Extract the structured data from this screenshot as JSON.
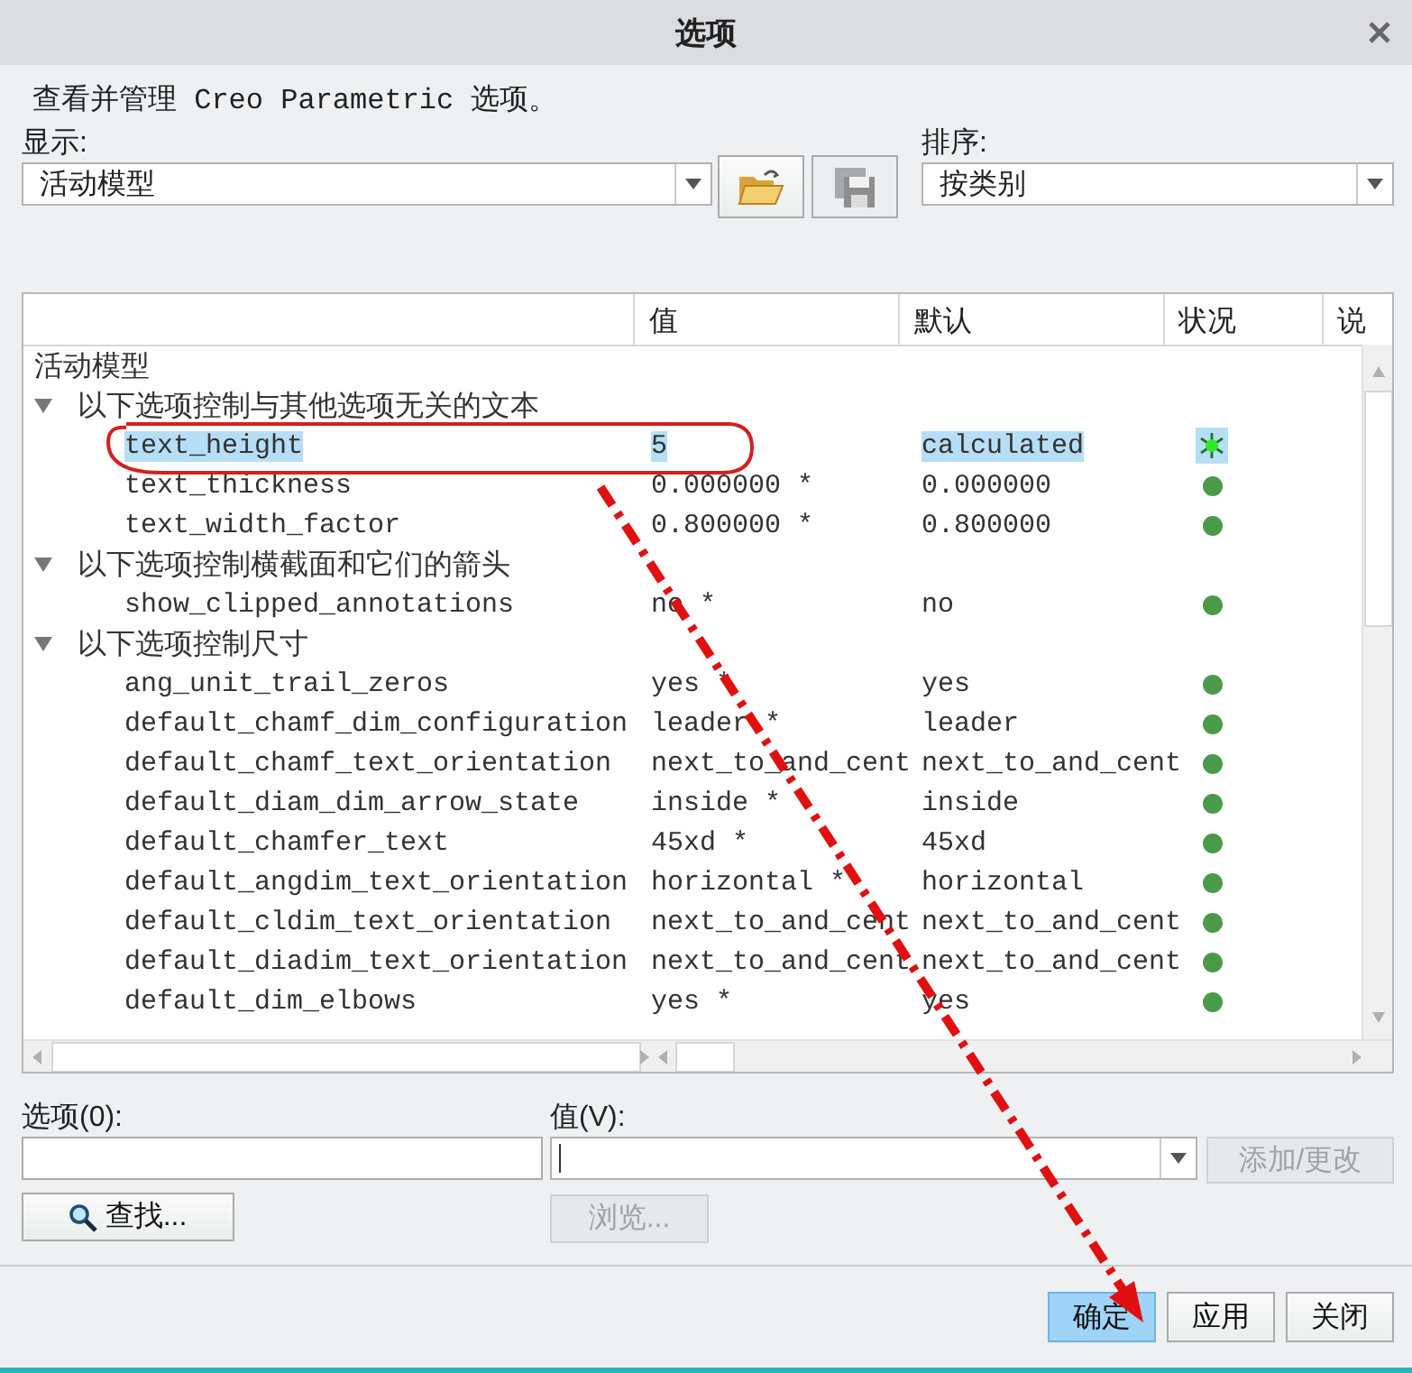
{
  "window": {
    "title": "选项"
  },
  "description": "查看并管理 Creo Parametric 选项。",
  "display": {
    "label": "显示:",
    "value": "活动模型"
  },
  "toolbar": [
    {
      "kind": "open",
      "disabled": false
    },
    {
      "kind": "save",
      "disabled": true
    }
  ],
  "sort": {
    "label": "排序:",
    "value": "按类别"
  },
  "table": {
    "columns": [
      "值",
      "默认",
      "状况",
      "说"
    ],
    "tree": {
      "label": "活动模型",
      "children": [
        {
          "label": "以下选项控制与其他选项无关的文本",
          "expanded": true,
          "children": [
            {
              "name": "text_height",
              "value": "5",
              "default": "calculated",
              "selected": true,
              "pending": true
            },
            {
              "name": "text_thickness",
              "value": "0.000000 *",
              "default": "0.000000",
              "selected": false,
              "pending": false
            },
            {
              "name": "text_width_factor",
              "value": "0.800000 *",
              "default": "0.800000",
              "selected": false,
              "pending": false
            }
          ]
        },
        {
          "label": "以下选项控制横截面和它们的箭头",
          "expanded": true,
          "children": [
            {
              "name": "show_clipped_annotations",
              "value": "no *",
              "default": "no",
              "selected": false,
              "pending": false
            }
          ]
        },
        {
          "label": "以下选项控制尺寸",
          "expanded": true,
          "children": [
            {
              "name": "ang_unit_trail_zeros",
              "value": "yes *",
              "default": "yes",
              "selected": false,
              "pending": false
            },
            {
              "name": "default_chamf_dim_configuration",
              "value": "leader *",
              "default": "leader",
              "selected": false,
              "pending": false
            },
            {
              "name": "default_chamf_text_orientation",
              "value": "next_to_and_cent",
              "default": "next_to_and_cent",
              "selected": false,
              "pending": false
            },
            {
              "name": "default_diam_dim_arrow_state",
              "value": "inside *",
              "default": "inside",
              "selected": false,
              "pending": false
            },
            {
              "name": "default_chamfer_text",
              "value": "45xd *",
              "default": "45xd",
              "selected": false,
              "pending": false
            },
            {
              "name": "default_angdim_text_orientation",
              "value": "horizontal *",
              "default": "horizontal",
              "selected": false,
              "pending": false
            },
            {
              "name": "default_cldim_text_orientation",
              "value": "next_to_and_cent",
              "default": "next_to_and_cent",
              "selected": false,
              "pending": false
            },
            {
              "name": "default_diadim_text_orientation",
              "value": "next_to_and_cent",
              "default": "next_to_and_cent",
              "selected": false,
              "pending": false
            },
            {
              "name": "default_dim_elbows",
              "value": "yes *",
              "default": "yes",
              "selected": false,
              "pending": false
            }
          ]
        }
      ]
    }
  },
  "option_field": {
    "label": "选项(0):"
  },
  "value_field": {
    "label": "值(V):"
  },
  "add_button": {
    "label": "添加/更改",
    "disabled": true
  },
  "find_button": {
    "label": "查找...",
    "disabled": false
  },
  "browse_button": {
    "label": "浏览...",
    "disabled": true
  },
  "footer": [
    {
      "label": "确定",
      "default": true
    },
    {
      "label": "应用",
      "default": false
    },
    {
      "label": "关闭",
      "default": false
    }
  ],
  "annotations": {
    "ellipse": true,
    "arrow": true
  }
}
